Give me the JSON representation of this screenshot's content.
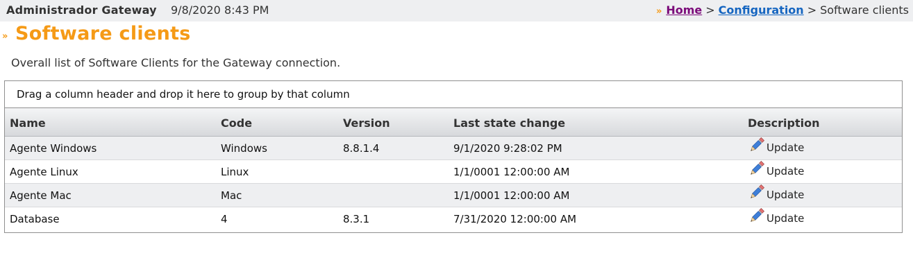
{
  "header": {
    "app_title": "Administrador Gateway",
    "datetime": "9/8/2020 8:43 PM",
    "breadcrumb": {
      "home": "Home",
      "configuration": "Configuration",
      "current": "Software clients",
      "separator": ">"
    }
  },
  "page": {
    "title": "Software clients",
    "description": "Overall list of Software Clients for the Gateway connection."
  },
  "grid": {
    "group_panel_text": "Drag a column header and drop it here to group by that column",
    "columns": [
      "Name",
      "Code",
      "Version",
      "Last state change",
      "Description"
    ],
    "rows": [
      {
        "name": "Agente Windows",
        "code": "Windows",
        "version": "8.8.1.4",
        "last_state_change": "9/1/2020 9:28:02 PM",
        "action": "Update"
      },
      {
        "name": "Agente Linux",
        "code": "Linux",
        "version": "",
        "last_state_change": "1/1/0001 12:00:00 AM",
        "action": "Update"
      },
      {
        "name": "Agente Mac",
        "code": "Mac",
        "version": "",
        "last_state_change": "1/1/0001 12:00:00 AM",
        "action": "Update"
      },
      {
        "name": "Database",
        "code": "4",
        "version": "8.3.1",
        "last_state_change": "7/31/2020 12:00:00 AM",
        "action": "Update"
      }
    ]
  },
  "colors": {
    "accent_orange": "#f59a16",
    "link_visited": "#7b0b7a",
    "link_blue": "#1565c0",
    "alt_row": "#eeeff1"
  },
  "icons": {
    "breadcrumb_chevron": "double-chevron-right-icon",
    "update": "pencil-icon"
  }
}
